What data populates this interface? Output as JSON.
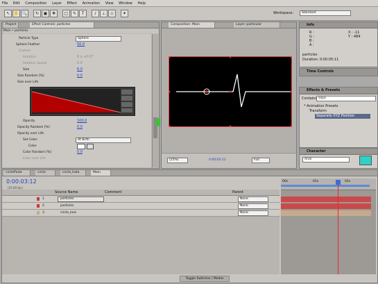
{
  "menubar": [
    "File",
    "Edit",
    "Composition",
    "Layer",
    "Effect",
    "Animation",
    "View",
    "Window",
    "Help"
  ],
  "workspace": {
    "label": "Workspace:",
    "value": "Standard"
  },
  "effect_controls": {
    "tabs": [
      "Project",
      "Effect Controls: particles"
    ],
    "breadcrumb": "Main • particles",
    "rows": [
      {
        "label": "Particle Type",
        "value": "Sphere"
      },
      {
        "label": "Sphere Feather",
        "value": "50.0"
      },
      {
        "label": "Custom",
        "value": ""
      },
      {
        "label": "Rotation",
        "value": "0 x +0.0°"
      },
      {
        "label": "Rotation Speed",
        "value": "0.0"
      },
      {
        "label": "Size",
        "value": "6.0"
      },
      {
        "label": "Size Random [%]",
        "value": "0.0"
      },
      {
        "label": "Size over Life",
        "value": ""
      },
      {
        "label": "Opacity",
        "value": "100.0"
      },
      {
        "label": "Opacity Random [%]",
        "value": "0.0"
      },
      {
        "label": "Opacity over Life",
        "value": ""
      },
      {
        "label": "Set Color",
        "value": "At Birth"
      },
      {
        "label": "Color",
        "value": ""
      },
      {
        "label": "Color Random [%]",
        "value": "0.0"
      },
      {
        "label": "Color over Life",
        "value": ""
      }
    ]
  },
  "composition": {
    "tabs": [
      "Composition: Main",
      "Layer: particular"
    ],
    "zoom": "(25%)",
    "timecode": "0:00:03:12",
    "resolution": "Full"
  },
  "info": {
    "title": "Info",
    "r": "R :",
    "g": "G :",
    "b": "B :",
    "a": "A :",
    "x": "X : -11",
    "y": "Y : 484",
    "layer_name": "particles",
    "duration": "Duration: 0:00:05:11"
  },
  "time_controls": {
    "title": "Time Controls"
  },
  "effects_presets": {
    "title": "Effects & Presets",
    "contains_label": "Contains:",
    "contains_value": "sepa",
    "items": [
      "* Animation Presets",
      "Transform",
      "Separate XYZ Position"
    ]
  },
  "character": {
    "title": "Character",
    "font": "Arial"
  },
  "timeline": {
    "tabs": [
      "circlePulse",
      "circle",
      "circle_hata",
      "Main"
    ],
    "timecode": "0:00:03:12",
    "fps": "(25.00 fps)",
    "columns": {
      "source": "Source Name",
      "comment": "Comment",
      "parent": "Parent"
    },
    "layers": [
      {
        "num": "1",
        "name": "particles",
        "parent": "None",
        "color": "#c73a3a",
        "bar": "#c94a4a"
      },
      {
        "num": "2",
        "name": "particles",
        "parent": "None",
        "color": "#c73a3a",
        "bar": "#c94a4a"
      },
      {
        "num": "3",
        "name": "circle_kais",
        "parent": "None",
        "color": "#c7a985",
        "bar": "#c4ab8d"
      }
    ],
    "ruler": [
      "00s",
      "01s",
      "02s"
    ],
    "footer": "Toggle Switches / Modes"
  },
  "colors": {
    "accent": "#1f3fc4",
    "bg": "#a9a9a9",
    "comp_bg": "#000000"
  }
}
